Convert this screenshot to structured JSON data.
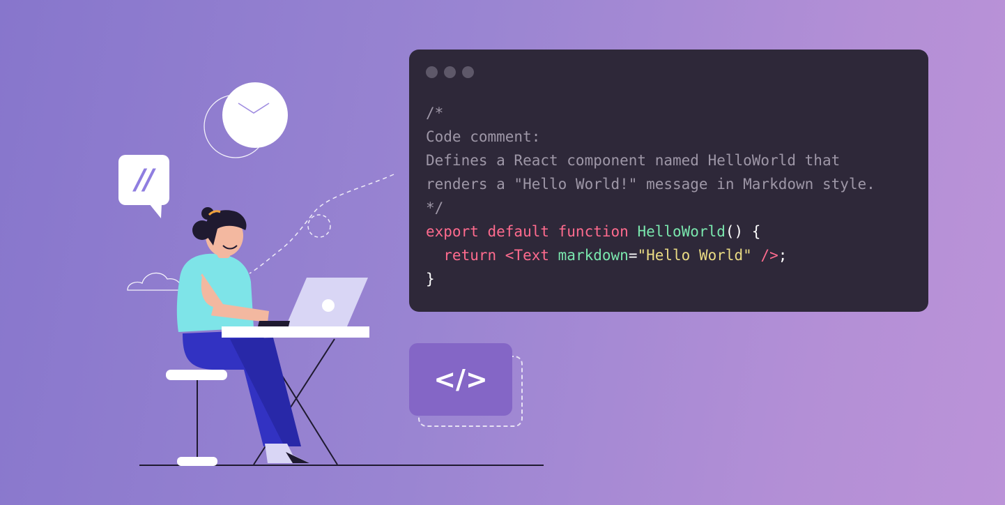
{
  "code_window": {
    "lines": [
      [
        {
          "t": "/*",
          "c": "cm"
        }
      ],
      [
        {
          "t": "Code comment:",
          "c": "cm"
        }
      ],
      [
        {
          "t": "Defines a React component named HelloWorld that",
          "c": "cm"
        }
      ],
      [
        {
          "t": "renders a \"Hello World!\" message in Markdown style.",
          "c": "cm"
        }
      ],
      [
        {
          "t": "*/",
          "c": "cm"
        }
      ],
      [
        {
          "t": "export default function ",
          "c": "kw"
        },
        {
          "t": "HelloWorld",
          "c": "fn"
        },
        {
          "t": "() {",
          "c": "pl"
        }
      ],
      [
        {
          "t": "  return ",
          "c": "kw"
        },
        {
          "t": "<Text ",
          "c": "kw"
        },
        {
          "t": "markdown",
          "c": "fn"
        },
        {
          "t": "=",
          "c": "pl"
        },
        {
          "t": "\"Hello World\"",
          "c": "st"
        },
        {
          "t": " />",
          "c": "kw"
        },
        {
          "t": ";",
          "c": "pl"
        }
      ],
      [
        {
          "t": "}",
          "c": "pl"
        }
      ]
    ]
  },
  "badge": {
    "label": "</>"
  },
  "speech_bubble": {
    "label": "//"
  },
  "icons": [
    "window-dots-icon",
    "envelope-icon",
    "speech-bubble-icon",
    "cloud-icon",
    "code-tag-icon"
  ],
  "colors": {
    "background_start": "#8776cc",
    "background_end": "#bb93d8",
    "code_bg": "#2e2839",
    "comment": "#9e97a7",
    "keyword": "#ff6b8e",
    "function": "#7ae7ae",
    "string": "#eadb84"
  }
}
